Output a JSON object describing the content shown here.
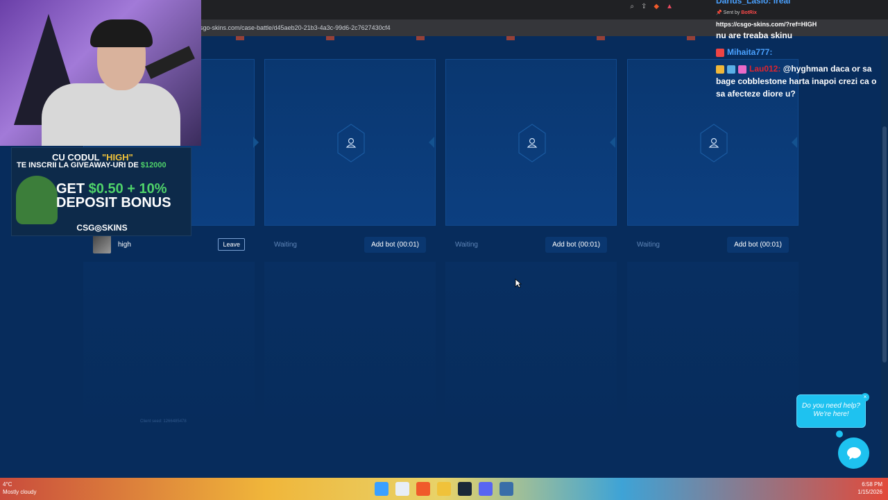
{
  "browser": {
    "url": "sgo-skins.com/case-battle/d45aeb20-21b3-4a3c-99d6-2c7627430cf4"
  },
  "battle": {
    "slots": [
      {
        "state": "user",
        "username": "high",
        "action_label": "Leave"
      },
      {
        "state": "waiting",
        "status_label": "Waiting",
        "action_label": "Add bot (00:01)"
      },
      {
        "state": "waiting",
        "status_label": "Waiting",
        "action_label": "Add bot (00:01)"
      },
      {
        "state": "waiting",
        "status_label": "Waiting",
        "action_label": "Add bot (00:01)"
      }
    ],
    "client_seed": "Client seed: 1266485478"
  },
  "promo": {
    "line1_prefix": "CU CODUL ",
    "line1_code": "\"HIGH\"",
    "line2_prefix": "TE INSCRII LA GIVEAWAY-URI DE ",
    "line2_amount": "$12000",
    "line3_prefix": "GET ",
    "line3_amount": "$0.50 + 10%",
    "line4": "DEPOSIT BONUS",
    "brand": "CSG◎SKINS"
  },
  "chat": {
    "top_line": "Darius_Laslo: ireal",
    "pinned_prefix": "Sent by ",
    "pinned_user": "BotRix",
    "pinned_link": "https://csgo-skins.com/?ref=HIGH",
    "line_skin": "nu are treaba skinu",
    "mihaita_name": "Mihaita777:",
    "lau_name": "Lau012:",
    "lau_message": " @hyghman daca or sa bage cobblestone harta inapoi crezi ca o sa afecteze diore u?"
  },
  "help": {
    "bubble_text": "Do you need help? We're here!"
  },
  "taskbar": {
    "temp": "4°C",
    "weather": "Mostly cloudy",
    "time": "6:58 PM",
    "date": "1/15/2026"
  },
  "colors": {
    "page_bg": "#072c5c",
    "accent_cyan": "#1ec2f0",
    "chat_name_blue": "#4aa1ff",
    "chat_name_red": "#e0242e",
    "promo_green": "#4fd36a",
    "promo_gold": "#f0c23a"
  }
}
